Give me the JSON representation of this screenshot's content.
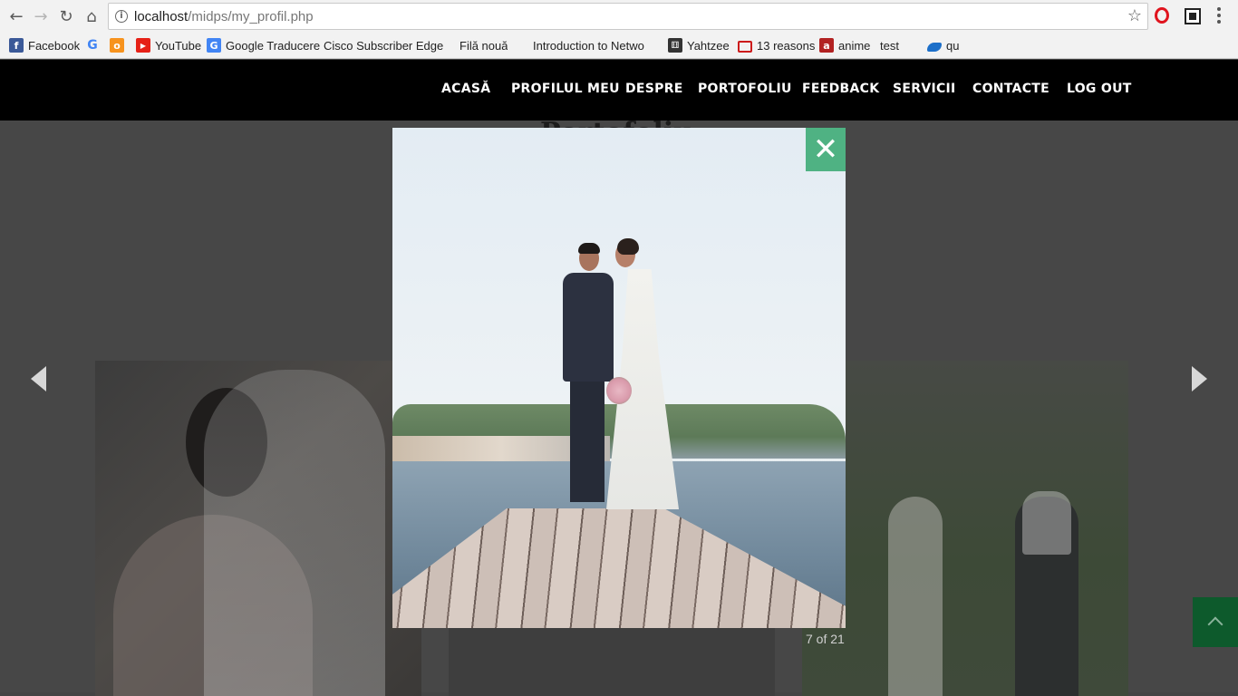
{
  "browser": {
    "url_host": "localhost",
    "url_path": "/midps/my_profil.php",
    "icons": {
      "back": "arrow-left-icon",
      "forward": "arrow-right-icon",
      "reload": "reload-icon",
      "home": "home-icon",
      "bookmark_star": "star-icon",
      "menu": "kebab-menu-icon"
    },
    "bookmarks": [
      {
        "label": "Facebook",
        "icon": "facebook-icon",
        "color": "#3b5998"
      },
      {
        "label": "",
        "icon": "google-icon",
        "color": "#4285f4"
      },
      {
        "label": "",
        "icon": "odnoklassniki-icon",
        "color": "#f7931e"
      },
      {
        "label": "YouTube",
        "icon": "youtube-icon",
        "color": "#e62117"
      },
      {
        "label": "Google Traducere",
        "icon": "translate-icon",
        "color": "#4285f4"
      },
      {
        "label": "Cisco Subscriber Edge",
        "icon": "page-icon",
        "color": "#666666"
      },
      {
        "label": "Filă nouă",
        "icon": "page-icon",
        "color": "#666666"
      },
      {
        "label": "Introduction to Netwo",
        "icon": "page-icon",
        "color": "#666666"
      },
      {
        "label": "Yahtzee",
        "icon": "dice-icon",
        "color": "#333333"
      },
      {
        "label": "13 reasons",
        "icon": "tv-icon",
        "color": "#cc1b1b"
      },
      {
        "label": "anime",
        "icon": "anime-icon",
        "color": "#b22222"
      },
      {
        "label": "test",
        "icon": "page-icon",
        "color": "#666666"
      },
      {
        "label": "qu",
        "icon": "cloud-icon",
        "color": "#1c6fc9"
      }
    ]
  },
  "site_nav": {
    "items": [
      "ACASĂ",
      "PROFILUL MEU",
      "DESPRE",
      "PORTOFOLIU",
      "FEEDBACK",
      "SERVICII",
      "CONTACTE",
      "LOG OUT"
    ]
  },
  "page": {
    "title": "Portofoliu"
  },
  "lightbox": {
    "counter": "7 of 21",
    "close_icon": "close-icon",
    "accent_color": "#4fb283",
    "image_alt": "wedding-couple-on-pier-photo"
  },
  "controls": {
    "prev_icon": "triangle-left-icon",
    "next_icon": "triangle-right-icon",
    "back_to_top_icon": "chevron-up-icon",
    "back_to_top_color": "#0d5a2c"
  }
}
